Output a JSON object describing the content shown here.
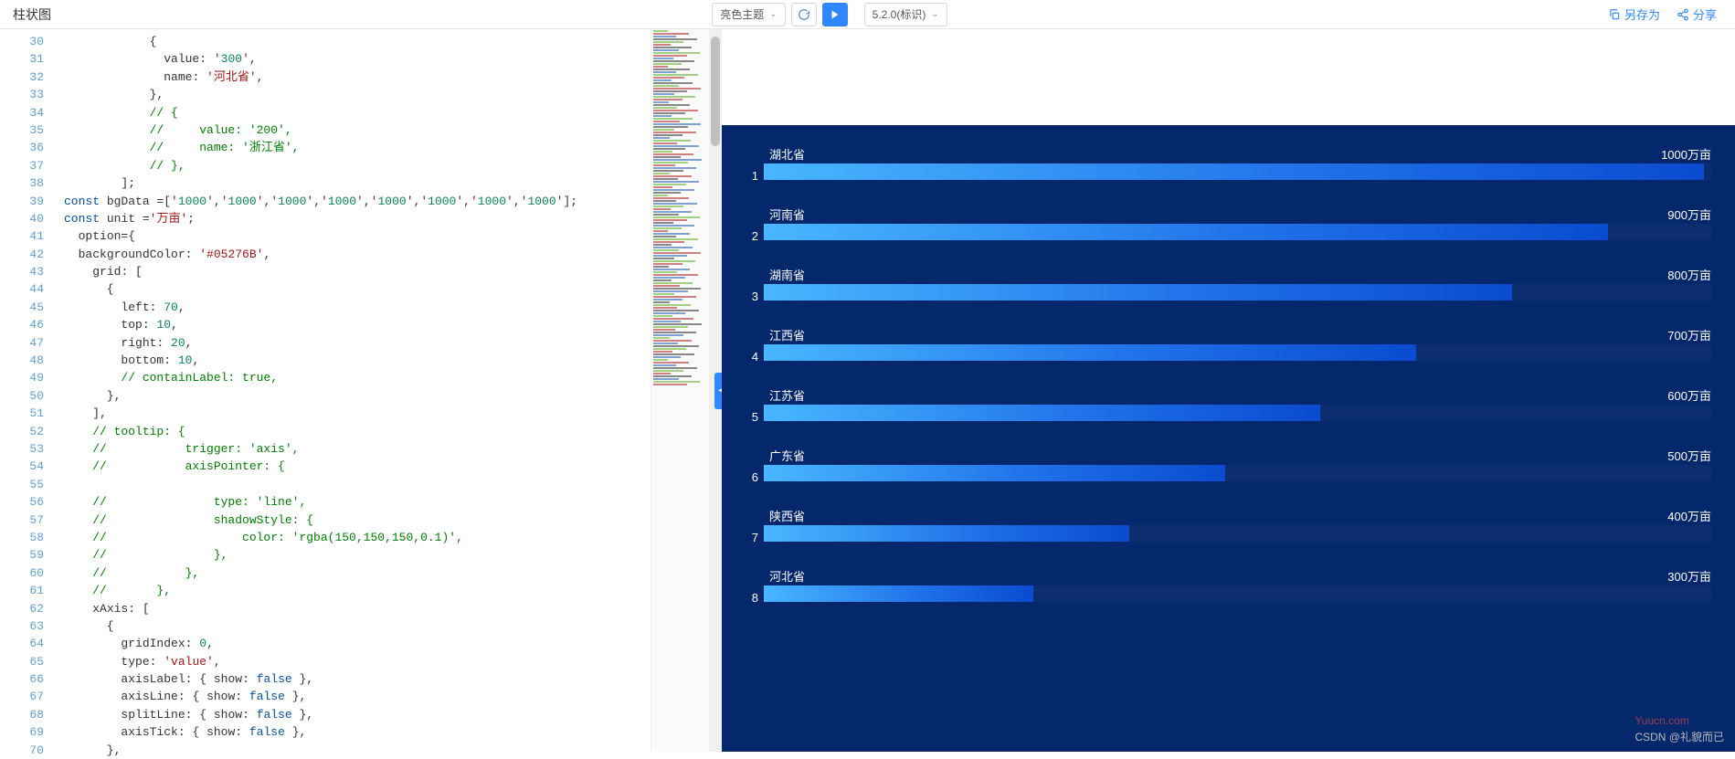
{
  "title": "柱状图",
  "toolbar": {
    "theme_select": "亮色主题",
    "version_select": "5.2.0(标识)",
    "save_as": "另存为",
    "share": "分享"
  },
  "line_start": 30,
  "line_end": 70,
  "code_lines": [
    "            {",
    "              value: '300',",
    "              name: '河北省',",
    "            },",
    "            // {",
    "            //     value: '200',",
    "            //     name: '浙江省',",
    "            // },",
    "        ];",
    "const bgData =['1000','1000','1000','1000','1000','1000','1000','1000'];",
    "const unit ='万亩';",
    "  option={",
    "  backgroundColor: '#05276B',",
    "    grid: [",
    "      {",
    "        left: 70,",
    "        top: 10,",
    "        right: 20,",
    "        bottom: 10,",
    "        // containLabel: true,",
    "      },",
    "    ],",
    "    // tooltip: {",
    "    //           trigger: 'axis',",
    "    //           axisPointer: {",
    "",
    "    //               type: 'line',",
    "    //               shadowStyle: {",
    "    //                   color: 'rgba(150,150,150,0.1)',",
    "    //               },",
    "    //           },",
    "    //       },",
    "    xAxis: [",
    "      {",
    "        gridIndex: 0,",
    "        type: 'value',",
    "        axisLabel: { show: false },",
    "        axisLine: { show: false },",
    "        splitLine: { show: false },",
    "        axisTick: { show: false },",
    "      },"
  ],
  "chart_data": {
    "type": "bar",
    "orientation": "horizontal",
    "unit": "万亩",
    "max": 1000,
    "background_color": "#05276B",
    "categories": [
      "湖北省",
      "河南省",
      "湖南省",
      "江西省",
      "江苏省",
      "广东省",
      "陕西省",
      "河北省"
    ],
    "values": [
      1000,
      900,
      800,
      700,
      600,
      500,
      400,
      300
    ],
    "index": [
      1,
      2,
      3,
      4,
      5,
      6,
      7,
      8
    ],
    "bg_values": [
      1000,
      1000,
      1000,
      1000,
      1000,
      1000,
      1000,
      1000
    ]
  },
  "watermark": {
    "site": "Yuucn.com",
    "author": "CSDN @礼貌而已"
  }
}
